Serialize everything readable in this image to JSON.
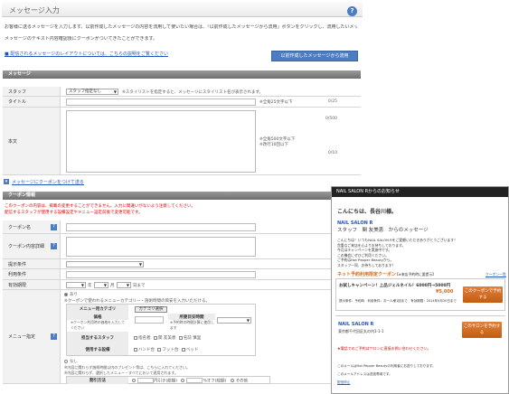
{
  "header": {
    "title": "メッセージ入力",
    "help_icon": "?"
  },
  "intro": {
    "line1": "お客様に送るメッセージを入力します。以前作成したメッセージの内容を流用して使いたい場合は、「以前作成したメッセージから流用」ボタンをクリックし、流用したいメッセージを選択してください。",
    "line2": "メッセージのテキスト内容確認後にクーポンがついてきたことができます。",
    "link": "■ 配信されるメッセージのレイアウトについては、こちらの説明をご覧ください",
    "copy_button": "以前作成したメッセージから流用"
  },
  "message_section": {
    "title": "メッセージ",
    "staff_label": "スタッフ",
    "staff_select": "スタッフ指定なし",
    "staff_hint": "※スタイリストを指定すると、メッセージにスタイリスト名が表示されます。",
    "title_label": "タイトル",
    "title_hint": "※全角25文字以下",
    "title_count": "0/25",
    "body_label": "本文",
    "body_hint1": "※全角500文字以下",
    "body_hint2": "※改行10回以下",
    "body_count": "0/500",
    "body_count2": "0/10",
    "add_coupon": "メッセージにクーポンをつけて送る"
  },
  "coupon_section": {
    "title": "クーポン情報",
    "warn1": "このクーポンの内容は、掲載の変更することができません。入力に間違いがないよう注意してください。",
    "warn2": "配信するスタッフが使用する設備設定やメニュー設定前後で変更可能です。",
    "name_label": "クーポン名",
    "detail_label": "クーポン内容詳細",
    "condition_label": "提示条件",
    "usage_label": "利用条件",
    "period_label": "有効期限",
    "year_suffix": "年",
    "month_suffix": "月",
    "day_suffix": "日まで",
    "menu_label": "メニュー指定",
    "menu_yes": "あり",
    "menu_yes_note": "※クーポンで使われるメニューカテゴリー・施術時間の目安を入力いただける。",
    "category_head": "メニュー用カテゴリ",
    "category_button": "カテゴリ選択",
    "price_head": "価格",
    "price_note": "※クーポン利用時の価格を入力してください",
    "time_head": "所要目安時間",
    "time_note": "※予約時の時間計算に使用します",
    "staff_head": "担当するスタッフ",
    "staffs": [
      "指名者",
      "関 友美恵",
      "名前 慎里"
    ],
    "equipment_head": "使用する設備",
    "equipments": [
      "ハンド台",
      "フット台",
      "ベッド"
    ],
    "menu_no": "なし",
    "menu_no_note1": "※内容に関わらず施術時間以内のプレゼント等は、こちらに入れてください。",
    "menu_no_note2": "※内容に関わらず、選択したメニュー・すべてにおいて適用されます。",
    "discount_head": "割引方法",
    "discount_opts": [
      "円引き(総額)",
      "%オフ(総額)",
      "その他"
    ]
  },
  "email_preview": {
    "header": "NAIL SALON Rからのお知らせ",
    "greeting": "こんにちは、長谷川様。",
    "shop": "NAIL SALON R",
    "staff_msg": "スタッフ　関 友美恵　からのメッセージ",
    "body_lines": [
      "こんにちは！いつもNAIL SALON Rをご愛顧いただきありがとうございます！",
      "貴重なご来店を心よりお待ちしております。",
      "今月はキャンペーンを実施中です。",
      "この機会にぜひご利用ください。",
      "ご予約はHot Pepper Beautyから。",
      "スタッフ一同、お待ちしております！"
    ],
    "coupon_title": "ネット予約利用限定クーポン",
    "coupon_note": "【※来店予約時に要提示】",
    "coupon_link": "クーポン一覧",
    "coupon_name": "お試しキャンペーン！上品ジェルネイル！6000円→5000円",
    "coupon_price": "¥5,000",
    "coupon_detail": "提示条件：予約時　利用条件：お一人様1回まで　有効期限：2014年9月30日まで",
    "coupon_btn": "このクーポンで予約する",
    "shop2": "NAIL SALON R",
    "shop2_addr": "東京都千代田区丸の内1-1-1",
    "shop2_btn": "このサロンを予約する",
    "reply_note": "★電話でのご予約はサロンに直接お問い合わせください。",
    "footer1": "このメールはHot Pepper Beautyの利用者にお送りしております。",
    "footer2": "このメールアドレスは送信専用です。",
    "footer_link": "配信停止"
  }
}
